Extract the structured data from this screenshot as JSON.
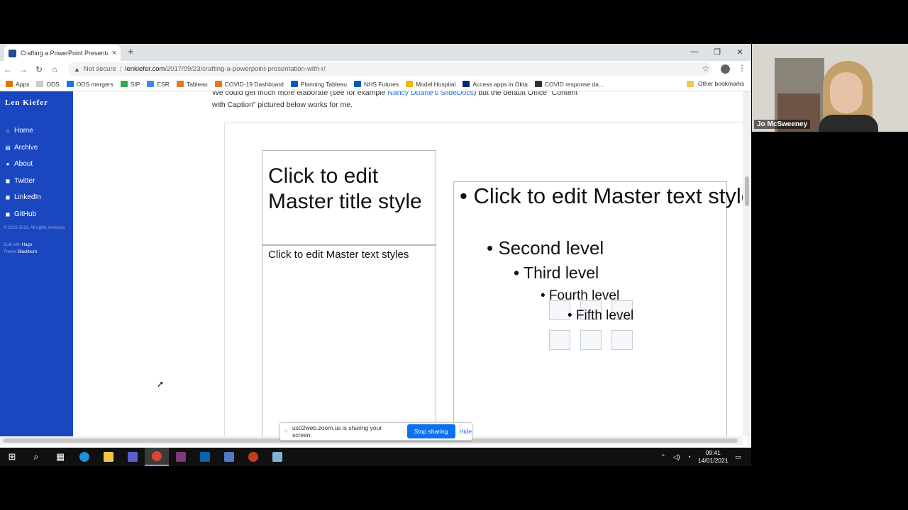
{
  "browser": {
    "tab_title": "Crafting a PowerPoint Presentation with R",
    "tab_close": "×",
    "new_tab": "+",
    "win_min": "—",
    "win_max": "❐",
    "win_close": "✕",
    "not_secure": "Not secure",
    "url_sep": "|",
    "url_host": "lenkiefer.com",
    "url_path": "/2017/09/23/crafting-a-powerpoint-presentation-with-r/"
  },
  "bookmarks": [
    {
      "label": "Apps",
      "color": "#e8710a"
    },
    {
      "label": "ODS",
      "color": "#cccccc"
    },
    {
      "label": "ODS mergers",
      "color": "#1a73e8"
    },
    {
      "label": "SIP",
      "color": "#34a853"
    },
    {
      "label": "ESR",
      "color": "#4285f4"
    },
    {
      "label": "Tableau",
      "color": "#e97627"
    },
    {
      "label": "COVID-19 Dashboard",
      "color": "#e97627"
    },
    {
      "label": "Planning Tableau",
      "color": "#005eb8"
    },
    {
      "label": "NHS Futures",
      "color": "#005eb8"
    },
    {
      "label": "Model Hospital",
      "color": "#f4b400"
    },
    {
      "label": "Access apps in Okta",
      "color": "#00297a"
    },
    {
      "label": "COVID response da...",
      "color": "#333333"
    }
  ],
  "other_bookmarks": "Other bookmarks",
  "sidebar": {
    "site_title": "Len Kiefer",
    "items": [
      {
        "icon": "⌂",
        "label": "Home"
      },
      {
        "icon": "▤",
        "label": "Archive"
      },
      {
        "icon": "●",
        "label": "About"
      },
      {
        "icon": "◼",
        "label": "Twitter"
      },
      {
        "icon": "◼",
        "label": "LinkedIn"
      },
      {
        "icon": "◼",
        "label": "GitHub"
      }
    ],
    "copyright": "© 2015-2019. All rights reserved.",
    "built_with": "Built with",
    "hugo": "Hugo",
    "theme": "Theme",
    "blackburn": "Blackburn"
  },
  "article": {
    "line1": "We could get much more elaborate (see for example ",
    "line1_link": "Nancy Duarte's SlideDocs",
    "line1_end": ") but the default Office \"Content",
    "line2": "with Caption\" pictured below works for me."
  },
  "slide": {
    "title": "Click to edit Master title style",
    "text": "Click to edit Master text styles",
    "level1": "• Click to edit Master text styles",
    "level2": "• Second level",
    "level3": "• Third level",
    "level4": "• Fourth level",
    "level5": "• Fifth level"
  },
  "sharebar": {
    "grip": "⁞⁞",
    "message": "us02web.zoom.us is sharing your screen.",
    "stop": "Stop sharing",
    "hide": "Hide"
  },
  "taskbar": {
    "time": "09:41",
    "date": "14/01/2021"
  },
  "video": {
    "name": "Jo McSweeney"
  }
}
